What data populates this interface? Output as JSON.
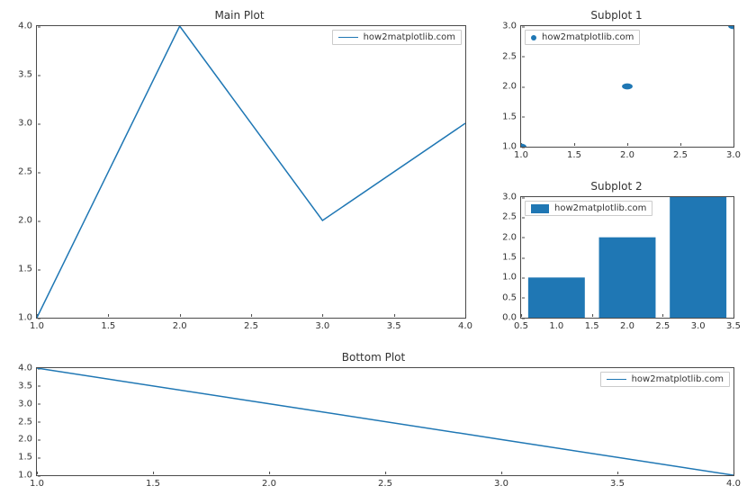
{
  "colors": {
    "line": "#1f77b4"
  },
  "legend_label": "how2matplotlib.com",
  "chart_data": [
    {
      "id": "main",
      "type": "line",
      "title": "Main Plot",
      "x": [
        1.0,
        2.0,
        3.0,
        4.0
      ],
      "y": [
        1.0,
        4.0,
        2.0,
        3.0
      ],
      "xlim": [
        1.0,
        4.0
      ],
      "ylim": [
        1.0,
        4.0
      ],
      "xticks": [
        "1.0",
        "1.5",
        "2.0",
        "2.5",
        "3.0",
        "3.5",
        "4.0"
      ],
      "yticks": [
        "1.0",
        "1.5",
        "2.0",
        "2.5",
        "3.0",
        "3.5",
        "4.0"
      ],
      "legend_pos": "right"
    },
    {
      "id": "sub1",
      "type": "scatter",
      "title": "Subplot 1",
      "x": [
        1.0,
        2.0,
        3.0
      ],
      "y": [
        1.0,
        2.0,
        3.0
      ],
      "xlim": [
        1.0,
        3.0
      ],
      "ylim": [
        1.0,
        3.0
      ],
      "xticks": [
        "1.0",
        "1.5",
        "2.0",
        "2.5",
        "3.0"
      ],
      "yticks": [
        "1.0",
        "1.5",
        "2.0",
        "2.5",
        "3.0"
      ],
      "legend_pos": "left"
    },
    {
      "id": "sub2",
      "type": "bar",
      "title": "Subplot 2",
      "categories_x": [
        1.0,
        2.0,
        3.0
      ],
      "values": [
        1.0,
        2.0,
        3.0
      ],
      "xlim": [
        0.5,
        3.5
      ],
      "ylim": [
        0.0,
        3.0
      ],
      "xticks": [
        "0.5",
        "1.0",
        "1.5",
        "2.0",
        "2.5",
        "3.0",
        "3.5"
      ],
      "yticks": [
        "0.0",
        "0.5",
        "1.0",
        "1.5",
        "2.0",
        "2.5",
        "3.0"
      ],
      "legend_pos": "left"
    },
    {
      "id": "bottom",
      "type": "line",
      "title": "Bottom Plot",
      "x": [
        1.0,
        2.0,
        3.0,
        4.0
      ],
      "y": [
        4.0,
        3.0,
        2.0,
        1.0
      ],
      "xlim": [
        1.0,
        4.0
      ],
      "ylim": [
        1.0,
        4.0
      ],
      "xticks": [
        "1.0",
        "1.5",
        "2.0",
        "2.5",
        "3.0",
        "3.5",
        "4.0"
      ],
      "yticks": [
        "1.0",
        "1.5",
        "2.0",
        "2.5",
        "3.0",
        "3.5",
        "4.0"
      ],
      "legend_pos": "right"
    }
  ]
}
